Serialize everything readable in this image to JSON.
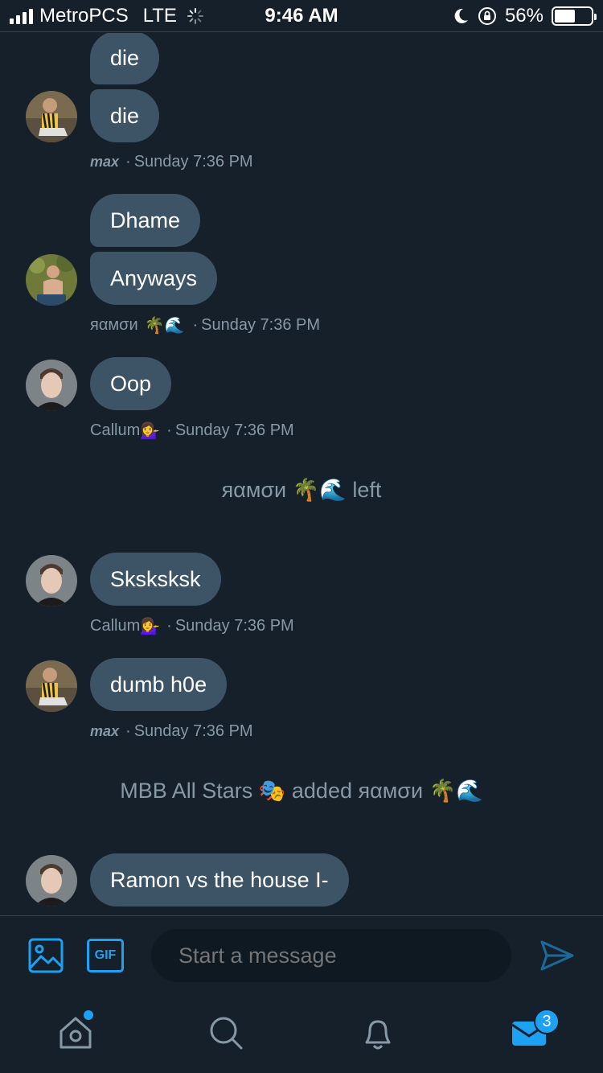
{
  "status_bar": {
    "carrier": "MetroPCS",
    "network": "LTE",
    "time": "9:46 AM",
    "battery_percent": "56%",
    "battery_level": 0.56
  },
  "thread": {
    "messages": [
      {
        "text": "die"
      },
      {
        "text": "die"
      },
      {
        "text": "Dhame"
      },
      {
        "text": "Anyways"
      },
      {
        "text": "Oop"
      },
      {
        "text": "Sksksksk"
      },
      {
        "text": "dumb h0e"
      },
      {
        "text": "Ramon vs the house I-"
      }
    ],
    "meta": [
      {
        "name": "max",
        "emoji": "",
        "time": "Sunday 7:36 PM"
      },
      {
        "name": "яαмσи",
        "emoji": "🌴🌊",
        "time": "Sunday 7:36 PM"
      },
      {
        "name": "Callum",
        "emoji": "💁‍♀️",
        "time": "Sunday 7:36 PM"
      },
      {
        "name": "Callum",
        "emoji": "💁‍♀️",
        "time": "Sunday 7:36 PM"
      },
      {
        "name": "max",
        "emoji": "",
        "time": "Sunday 7:36 PM"
      }
    ],
    "separator": "·",
    "system": [
      {
        "text": "яαмσи 🌴🌊 left"
      },
      {
        "text": "MBB All Stars 🎭 added яαмσи 🌴🌊"
      }
    ]
  },
  "composer": {
    "placeholder": "Start a message",
    "gif_label": "GIF"
  },
  "tab_bar": {
    "messages_badge": "3"
  },
  "colors": {
    "background": "#15202b",
    "bubble": "#3d5466",
    "accent": "#1da1f2",
    "muted_text": "#8899a6"
  },
  "icons": [
    "image-icon",
    "gif-icon",
    "send-icon",
    "home-icon",
    "search-icon",
    "bell-icon",
    "mail-icon"
  ]
}
